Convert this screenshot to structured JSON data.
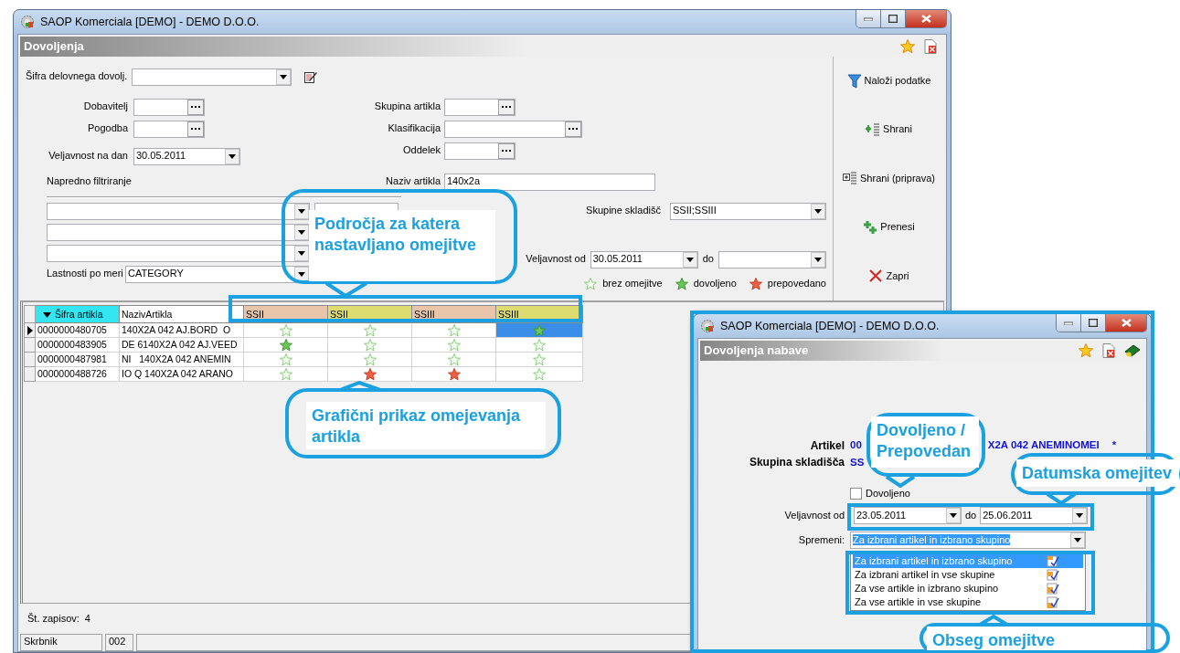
{
  "main_window": {
    "title": "SAOP Komerciala [DEMO] - DEMO D.O.O.",
    "panel_title": "Dovoljenja",
    "permit_code": {
      "label": "Šifra delovnega dovolj.",
      "kind": "combo"
    },
    "left_fields": [
      {
        "label": "Dobavitelj",
        "kind": "lookup"
      },
      {
        "label": "Pogodba",
        "kind": "lookup"
      },
      {
        "label": "Veljavnost na dan",
        "kind": "date",
        "value": "30.05.2011"
      }
    ],
    "right_fields": [
      {
        "label": "Skupina artikla",
        "kind": "lookup"
      },
      {
        "label": "Klasifikacija",
        "kind": "lookup_wide"
      },
      {
        "label": "Oddelek",
        "kind": "lookup"
      }
    ],
    "advanced_filter": {
      "label": "Napredno filtriranje",
      "rows": [
        {
          "kind": "combo_text"
        },
        {
          "kind": "combo"
        },
        {
          "kind": "combo"
        }
      ]
    },
    "custom_properties": {
      "label": "Lastnosti po meri",
      "value": "CATEGORY"
    },
    "article_name": {
      "label": "Naziv artikla",
      "value": "140x2a"
    },
    "warehouse_groups": {
      "label": "Skupine skladišč",
      "value": "SSII;SSIII"
    },
    "validity": {
      "label": "Veljavnost od",
      "from": "30.05.2011",
      "to_label": "do"
    },
    "legend": [
      {
        "kind": "none",
        "label": "brez omejitve"
      },
      {
        "kind": "allowed",
        "label": "dovoljeno"
      },
      {
        "kind": "forbidden",
        "label": "prepovedano"
      }
    ],
    "buttons": [
      {
        "kind": "load",
        "label": "Naloži podatke"
      },
      {
        "kind": "save",
        "label": "Shrani"
      },
      {
        "kind": "save_draft",
        "label": "Shrani (priprava)"
      },
      {
        "kind": "transfer",
        "label": "Prenesi"
      },
      {
        "kind": "close",
        "label": "Zapri"
      }
    ],
    "grid": {
      "columns": [
        {
          "label": "Šifra artikla",
          "sorted": true
        },
        {
          "label": "NazivArtikla",
          "sorted": false
        }
      ],
      "groups": [
        {
          "label": "SSII",
          "color": "#e8c4a8"
        },
        {
          "label": "SSII",
          "color": "#dcdc70"
        },
        {
          "label": "SSIII",
          "color": "#e8c4a8"
        },
        {
          "label": "SSIII",
          "color": "#dcdc70"
        }
      ],
      "rows": [
        {
          "code": "0000000480705",
          "name": "140X2A 042 AJ.BORD  O",
          "selected": true,
          "cells": [
            {
              "kind": "none",
              "selected": false
            },
            {
              "kind": "none",
              "selected": false
            },
            {
              "kind": "none",
              "selected": false
            },
            {
              "kind": "allowed",
              "selected": true
            }
          ]
        },
        {
          "code": "0000000483905",
          "name": "DE 6140X2A 042 AJ.VEED",
          "selected": false,
          "cells": [
            {
              "kind": "allowed",
              "selected": false
            },
            {
              "kind": "none",
              "selected": false
            },
            {
              "kind": "none",
              "selected": false
            },
            {
              "kind": "none",
              "selected": false
            }
          ]
        },
        {
          "code": "0000000487981",
          "name": "NI   140X2A 042 ANEMIN",
          "selected": false,
          "cells": [
            {
              "kind": "none",
              "selected": false
            },
            {
              "kind": "none",
              "selected": false
            },
            {
              "kind": "none",
              "selected": false
            },
            {
              "kind": "none",
              "selected": false
            }
          ]
        },
        {
          "code": "0000000488726",
          "name": "IO Q 140X2A 042 ARANO",
          "selected": false,
          "cells": [
            {
              "kind": "none",
              "selected": false
            },
            {
              "kind": "forbidden",
              "selected": false
            },
            {
              "kind": "forbidden",
              "selected": false
            },
            {
              "kind": "none",
              "selected": false
            }
          ]
        }
      ]
    },
    "record_count": {
      "label": "Št. zapisov:",
      "value": "4"
    },
    "status_bar": [
      {
        "text": "Skrbnik"
      },
      {
        "text": "002"
      }
    ]
  },
  "detail_window": {
    "title": "SAOP Komerciala [DEMO] - DEMO D.O.O.",
    "panel_title": "Dovoljenja nabave",
    "article": {
      "label": "Artikel",
      "value_start": "00",
      "value_end": "X2A 042 ANEMINOMEI",
      "marker": "*"
    },
    "warehouse_group": {
      "label": "Skupina skladišča",
      "value": "SS"
    },
    "allowed": {
      "label": "Dovoljeno",
      "checked": false
    },
    "validity": {
      "label": "Veljavnost od",
      "from": "23.05.2011",
      "to_label": "do",
      "to": "25.06.2011"
    },
    "change": {
      "label": "Spremeni:",
      "value": "Za izbrani artikel in izbrano skupino"
    },
    "scope_options": [
      {
        "label": "Za izbrani artikel in izbrano skupino",
        "selected": true
      },
      {
        "label": "Za izbrani artikel in vse skupine",
        "selected": false
      },
      {
        "label": "Za vse artikle in izbrano skupino",
        "selected": false
      },
      {
        "label": "Za vse artikle in vse skupine",
        "selected": false
      }
    ]
  },
  "callouts": [
    {
      "text": "Področja za katera nastavljano omejitve"
    },
    {
      "text": "Grafični prikaz omejevanja artikla"
    },
    {
      "text": "Dovoljeno / Prepovedan"
    },
    {
      "text": "Datumska omejitev"
    },
    {
      "text": "Obseg omejitve"
    }
  ]
}
